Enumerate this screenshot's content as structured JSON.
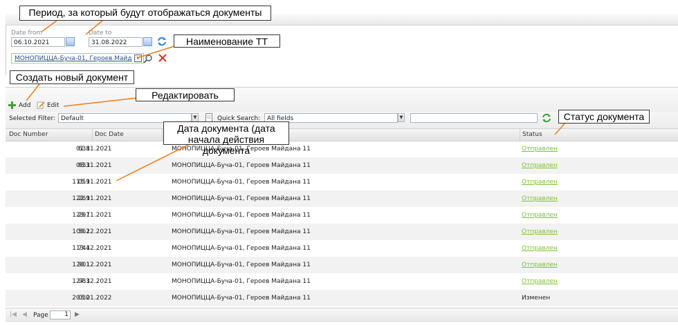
{
  "filters": {
    "date_from_label": "Date from",
    "date_to_label": "Date to",
    "date_from_value": "06.10.2021",
    "date_to_value": "31.08.2022",
    "store_value": "МОНОПИЦЦА-Буча-01, Героев Майд"
  },
  "toolbar": {
    "add_label": "Add",
    "edit_label": "Edit"
  },
  "filterbar": {
    "selected_filter_label": "Selected Filter:",
    "selected_filter_value": "Default",
    "quick_search_label": "Quick Search:",
    "quick_search_value": "All fields",
    "search_text_value": ""
  },
  "grid": {
    "columns": [
      "Doc Number",
      "Doc Date",
      "",
      "Status"
    ],
    "rows": [
      {
        "number": "638",
        "date": "01.11.2021",
        "store": "МОНОПИЦЦА-Буча-01, Героев Майдана 11",
        "status": "Отправлен",
        "link": true
      },
      {
        "number": "633",
        "date": "08.11.2021",
        "store": "МОНОПИЦЦА-Буча-01, Героев Майдана 11",
        "status": "Отправлен",
        "link": true
      },
      {
        "number": "1 059",
        "date": "15.11.2021",
        "store": "МОНОПИЦЦА-Буча-01, Героев Майдана 11",
        "status": "Отправлен",
        "link": true
      },
      {
        "number": "1 269",
        "date": "22.11.2021",
        "store": "МОНОПИЦЦА-Буча-01, Героев Майдана 11",
        "status": "Отправлен",
        "link": true
      },
      {
        "number": "1 297",
        "date": "29.11.2021",
        "store": "МОНОПИЦЦА-Буча-01, Героев Майдана 11",
        "status": "Отправлен",
        "link": true
      },
      {
        "number": "1 562",
        "date": "06.12.2021",
        "store": "МОНОПИЦЦА-Буча-01, Героев Майдана 11",
        "status": "Отправлен",
        "link": true
      },
      {
        "number": "1 744",
        "date": "13.12.2021",
        "store": "МОНОПИЦЦА-Буча-01, Героев Майдана 11",
        "status": "Отправлен",
        "link": true
      },
      {
        "number": "1 901",
        "date": "20.12.2021",
        "store": "МОНОПИЦЦА-Буча-01, Героев Майдана 11",
        "status": "Отправлен",
        "link": true
      },
      {
        "number": "1 983",
        "date": "27.12.2021",
        "store": "МОНОПИЦЦА-Буча-01, Героев Майдана 11",
        "status": "Отправлен",
        "link": true
      },
      {
        "number": "2 032",
        "date": "03.01.2022",
        "store": "МОНОПИЦЦА-Буча-01, Героев Майдана 11",
        "status": "Изменен",
        "link": false
      }
    ]
  },
  "pager": {
    "page_label": "Page",
    "page_value": "1"
  },
  "callouts": {
    "period": "Период, за который будут отображаться документы",
    "store_name": "Наименование ТТ",
    "create_doc": "Создать новый документ",
    "edit": "Редактировать",
    "doc_date_line1": "Дата документа (дата",
    "doc_date_line2": "начала действия документа",
    "doc_status": "Статус документа"
  },
  "colors": {
    "status_link": "#7cc12e",
    "add_icon": "#3aa335",
    "delete_icon": "#d9332b",
    "refresh_icon": "#2f7fd8",
    "store_border": "#a6d36b"
  }
}
